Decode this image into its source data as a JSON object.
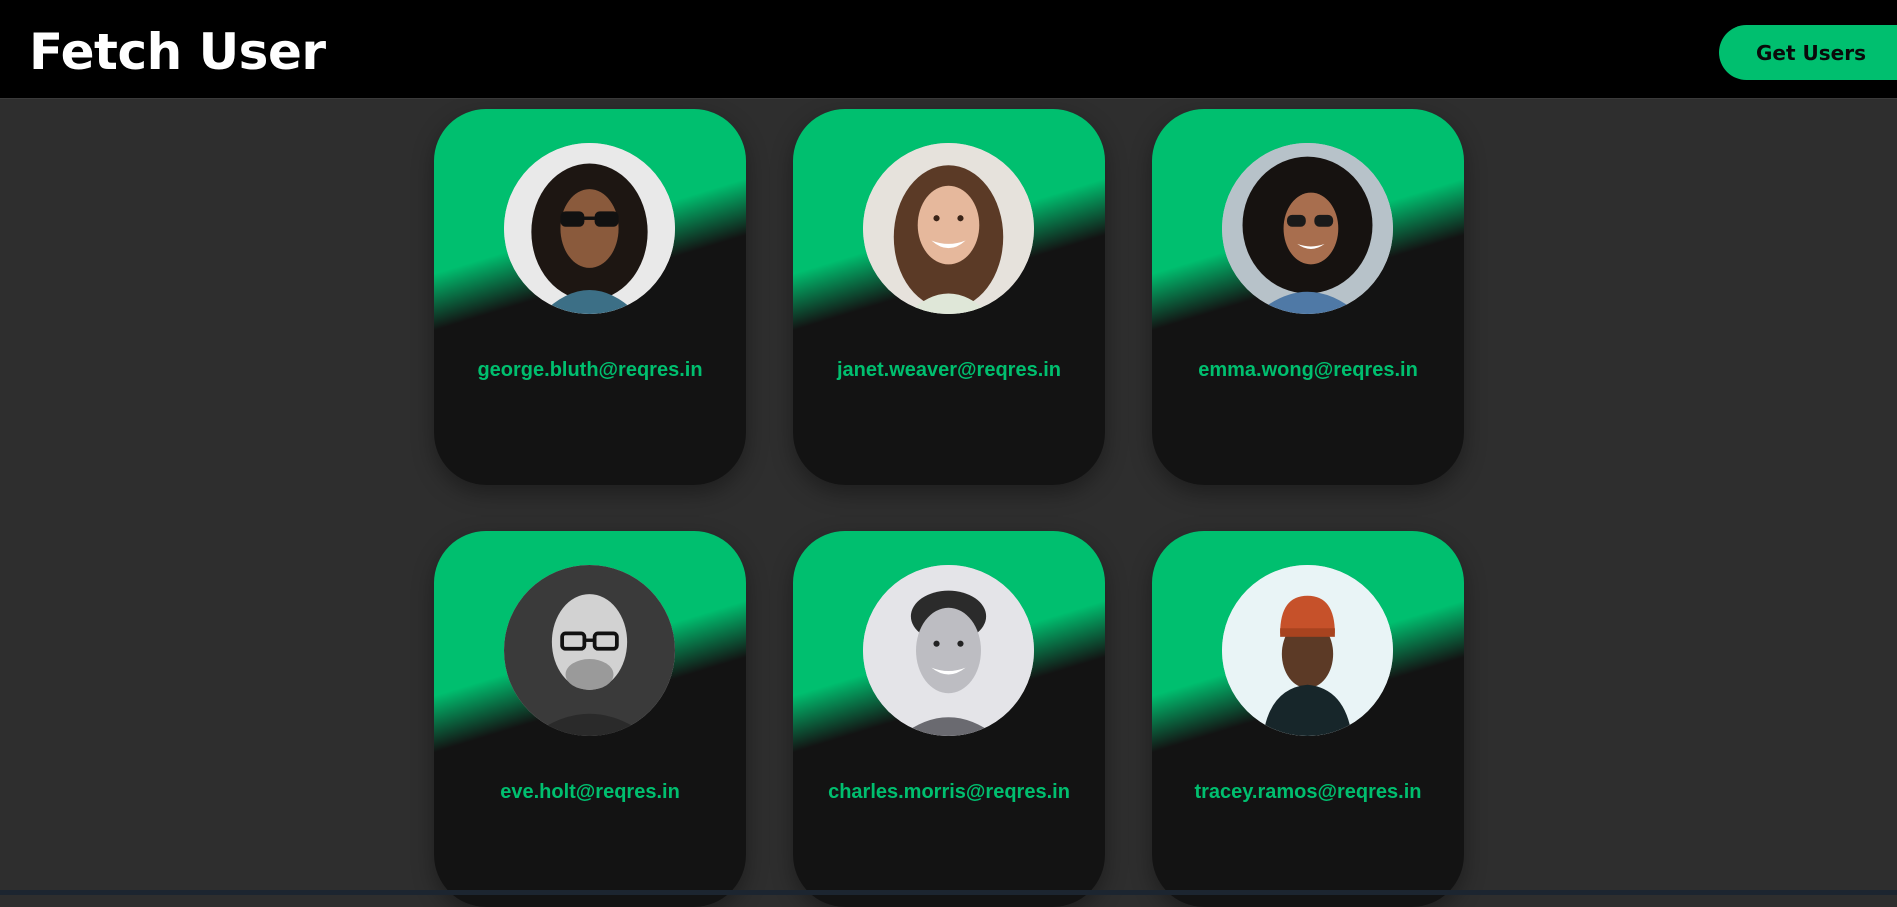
{
  "header": {
    "title": "Fetch User",
    "get_users_label": "Get Users"
  },
  "colors": {
    "accent": "#00bf6f",
    "card_dark": "#131313",
    "background": "#2e2e2e",
    "header_bg": "#000000"
  },
  "users": [
    {
      "email": "george.bluth@reqres.in",
      "avatar": "avatar-photo-man-sunglasses-curly-hair"
    },
    {
      "email": "janet.weaver@reqres.in",
      "avatar": "avatar-photo-woman-smiling-brown-hair"
    },
    {
      "email": "emma.wong@reqres.in",
      "avatar": "avatar-photo-woman-curly-hair-sunglasses"
    },
    {
      "email": "eve.holt@reqres.in",
      "avatar": "avatar-photo-man-glasses-beard-bw"
    },
    {
      "email": "charles.morris@reqres.in",
      "avatar": "avatar-photo-man-smiling-bw"
    },
    {
      "email": "tracey.ramos@reqres.in",
      "avatar": "avatar-photo-man-orange-beanie"
    }
  ]
}
